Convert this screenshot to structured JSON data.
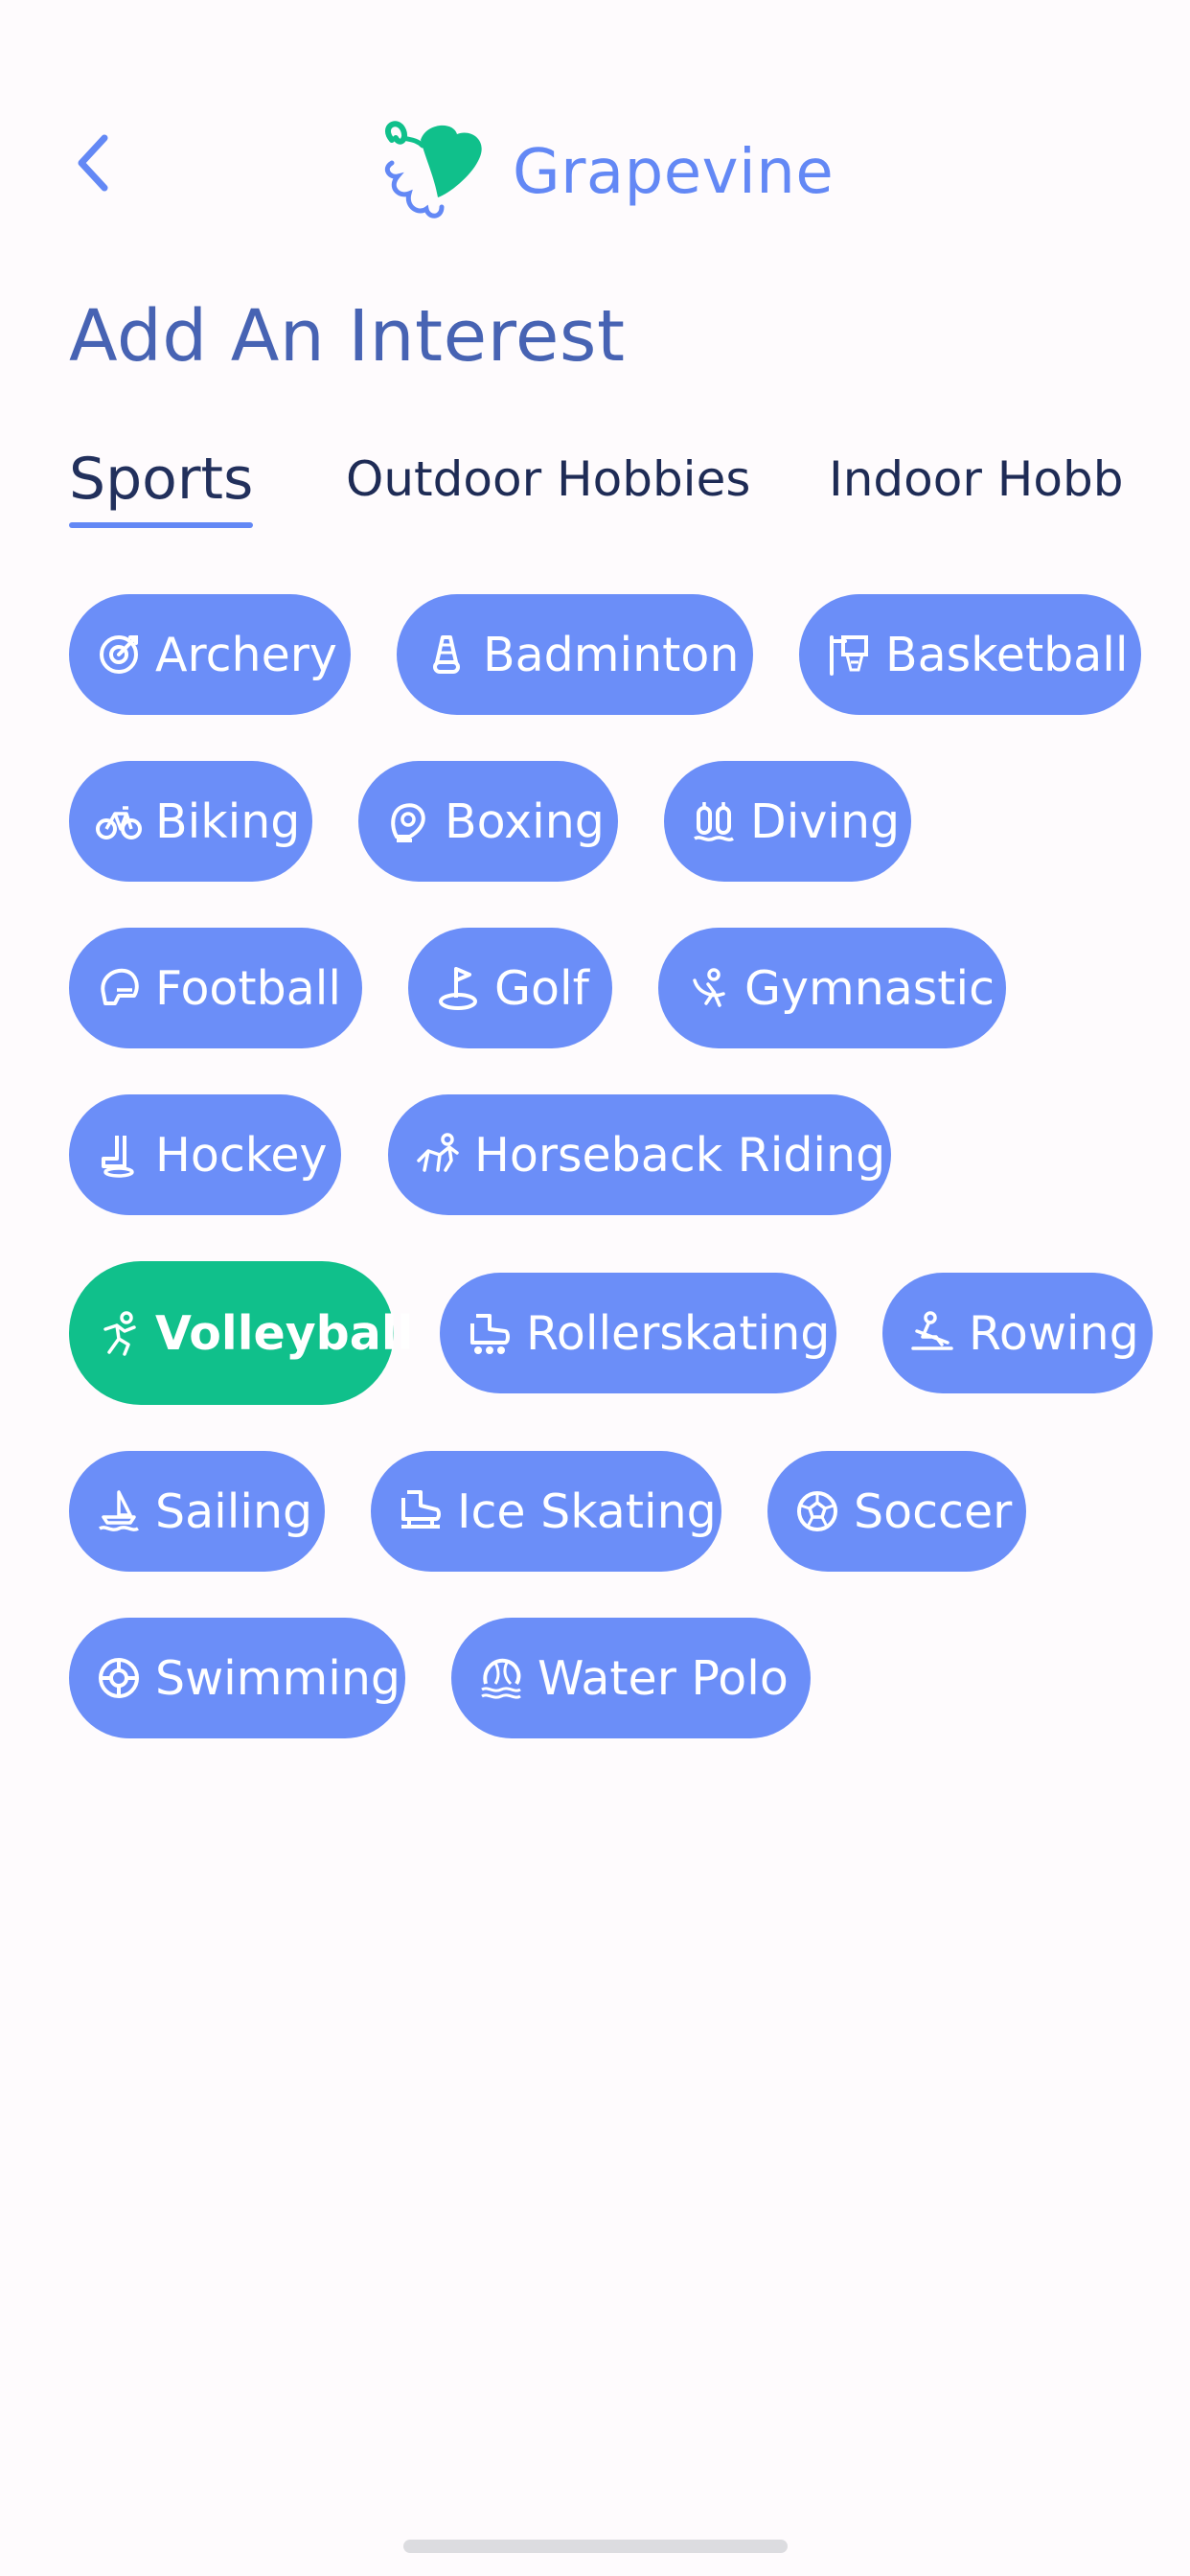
{
  "header": {
    "back_icon": "chevron-left-icon",
    "logo_icon": "grapevine-leaf-icon",
    "logo_text": "Grapevine"
  },
  "page": {
    "title": "Add An Interest"
  },
  "tabs": [
    {
      "label": "Sports",
      "active": true
    },
    {
      "label": "Outdoor Hobbies",
      "active": false
    },
    {
      "label": "Indoor Hobb",
      "active": false
    }
  ],
  "interests": [
    {
      "label": "Archery",
      "icon": "target-icon",
      "selected": false
    },
    {
      "label": "Badminton",
      "icon": "shuttlecock-icon",
      "selected": false
    },
    {
      "label": "Basketball",
      "icon": "basketball-hoop-icon",
      "selected": false
    },
    {
      "label": "Biking",
      "icon": "bicycle-icon",
      "selected": false
    },
    {
      "label": "Boxing",
      "icon": "boxing-glove-icon",
      "selected": false
    },
    {
      "label": "Diving",
      "icon": "diving-tanks-icon",
      "selected": false
    },
    {
      "label": "Football",
      "icon": "football-helmet-icon",
      "selected": false
    },
    {
      "label": "Golf",
      "icon": "golf-flag-icon",
      "selected": false
    },
    {
      "label": "Gymnastic",
      "icon": "gymnast-icon",
      "selected": false
    },
    {
      "label": "Hockey",
      "icon": "hockey-stick-icon",
      "selected": false
    },
    {
      "label": "Horseback Riding",
      "icon": "horse-rider-icon",
      "selected": false
    },
    {
      "label": "Volleyball",
      "icon": "volleyball-player-icon",
      "selected": true
    },
    {
      "label": "Rollerskating",
      "icon": "roller-skate-icon",
      "selected": false
    },
    {
      "label": "Rowing",
      "icon": "rower-icon",
      "selected": false
    },
    {
      "label": "Sailing",
      "icon": "sailboat-icon",
      "selected": false
    },
    {
      "label": "Ice Skating",
      "icon": "ice-skate-icon",
      "selected": false
    },
    {
      "label": "Soccer",
      "icon": "soccer-ball-icon",
      "selected": false
    },
    {
      "label": "Swimming",
      "icon": "life-ring-icon",
      "selected": false
    },
    {
      "label": "Water Polo",
      "icon": "water-ball-icon",
      "selected": false
    }
  ],
  "colors": {
    "background": "#FEFBFD",
    "chip": "#6B8EF8",
    "chip_selected": "#10C08B",
    "accent": "#6388F5",
    "title": "#4763B3",
    "tab_text": "#1E2B55"
  }
}
